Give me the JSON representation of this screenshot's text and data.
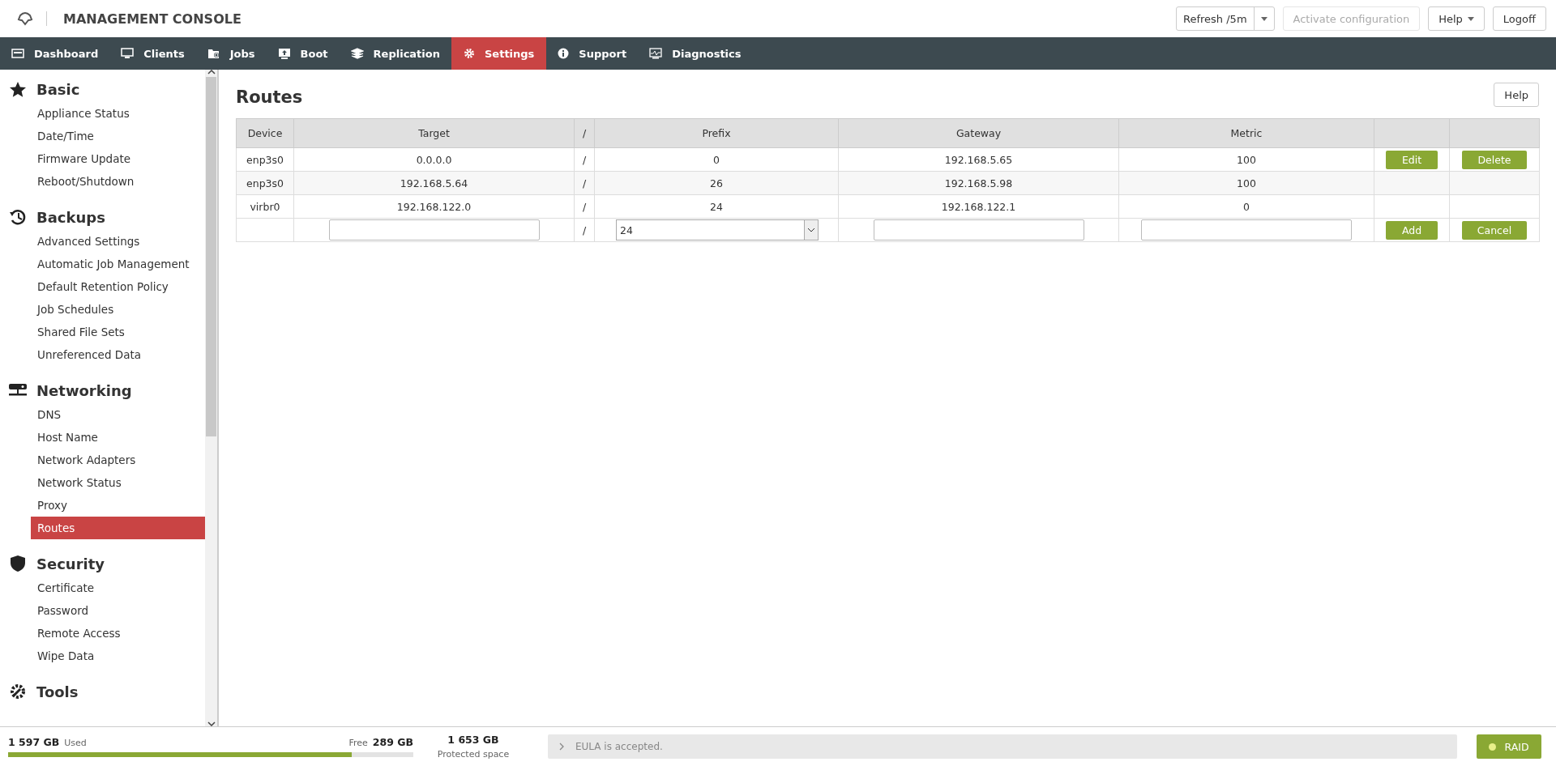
{
  "header": {
    "title": "MANAGEMENT CONSOLE",
    "refresh": "Refresh /5m",
    "activate": {
      "label": "Activate configuration",
      "disabled": true
    },
    "help": "Help",
    "logoff": "Logoff"
  },
  "nav": [
    {
      "label": "Dashboard",
      "selected": false
    },
    {
      "label": "Clients",
      "selected": false
    },
    {
      "label": "Jobs",
      "selected": false
    },
    {
      "label": "Boot",
      "selected": false
    },
    {
      "label": "Replication",
      "selected": false
    },
    {
      "label": "Settings",
      "selected": true
    },
    {
      "label": "Support",
      "selected": false
    },
    {
      "label": "Diagnostics",
      "selected": false
    }
  ],
  "sidebar": {
    "groups": [
      {
        "title": "Basic",
        "items": [
          {
            "label": "Appliance Status",
            "selected": false
          },
          {
            "label": "Date/Time",
            "selected": false
          },
          {
            "label": "Firmware Update",
            "selected": false
          },
          {
            "label": "Reboot/Shutdown",
            "selected": false
          }
        ]
      },
      {
        "title": "Backups",
        "items": [
          {
            "label": "Advanced Settings",
            "selected": false
          },
          {
            "label": "Automatic Job Management",
            "selected": false
          },
          {
            "label": "Default Retention Policy",
            "selected": false
          },
          {
            "label": "Job Schedules",
            "selected": false
          },
          {
            "label": "Shared File Sets",
            "selected": false
          },
          {
            "label": "Unreferenced Data",
            "selected": false
          }
        ]
      },
      {
        "title": "Networking",
        "items": [
          {
            "label": "DNS",
            "selected": false
          },
          {
            "label": "Host Name",
            "selected": false
          },
          {
            "label": "Network Adapters",
            "selected": false
          },
          {
            "label": "Network Status",
            "selected": false
          },
          {
            "label": "Proxy",
            "selected": false
          },
          {
            "label": "Routes",
            "selected": true
          }
        ]
      },
      {
        "title": "Security",
        "items": [
          {
            "label": "Certificate",
            "selected": false
          },
          {
            "label": "Password",
            "selected": false
          },
          {
            "label": "Remote Access",
            "selected": false
          },
          {
            "label": "Wipe Data",
            "selected": false
          }
        ]
      },
      {
        "title": "Tools"
      }
    ]
  },
  "page": {
    "title": "Routes",
    "help": "Help"
  },
  "table": {
    "columns": [
      "Device",
      "Target",
      "/",
      "Prefix",
      "Gateway",
      "Metric"
    ],
    "rows": [
      {
        "device": "enp3s0",
        "target": "0.0.0.0",
        "slash": "/",
        "prefix": "0",
        "gateway": "192.168.5.65",
        "metric": "100",
        "actions": [
          "Edit",
          "Delete"
        ]
      },
      {
        "device": "enp3s0",
        "target": "192.168.5.64",
        "slash": "/",
        "prefix": "26",
        "gateway": "192.168.5.98",
        "metric": "100"
      },
      {
        "device": "virbr0",
        "target": "192.168.122.0",
        "slash": "/",
        "prefix": "24",
        "gateway": "192.168.122.1",
        "metric": "0"
      }
    ],
    "new_row": {
      "slash": "/",
      "prefix": "24",
      "actions": [
        "Add",
        "Cancel"
      ]
    }
  },
  "footer": {
    "used": "1 597 GB",
    "used_label": "Used",
    "free_label": "Free",
    "free": "289 GB",
    "level": 0.847,
    "protected": "1 653 GB",
    "protected_label": "Protected space",
    "eula": "EULA is accepted.",
    "raid": "RAID",
    "raid_ok": true
  }
}
